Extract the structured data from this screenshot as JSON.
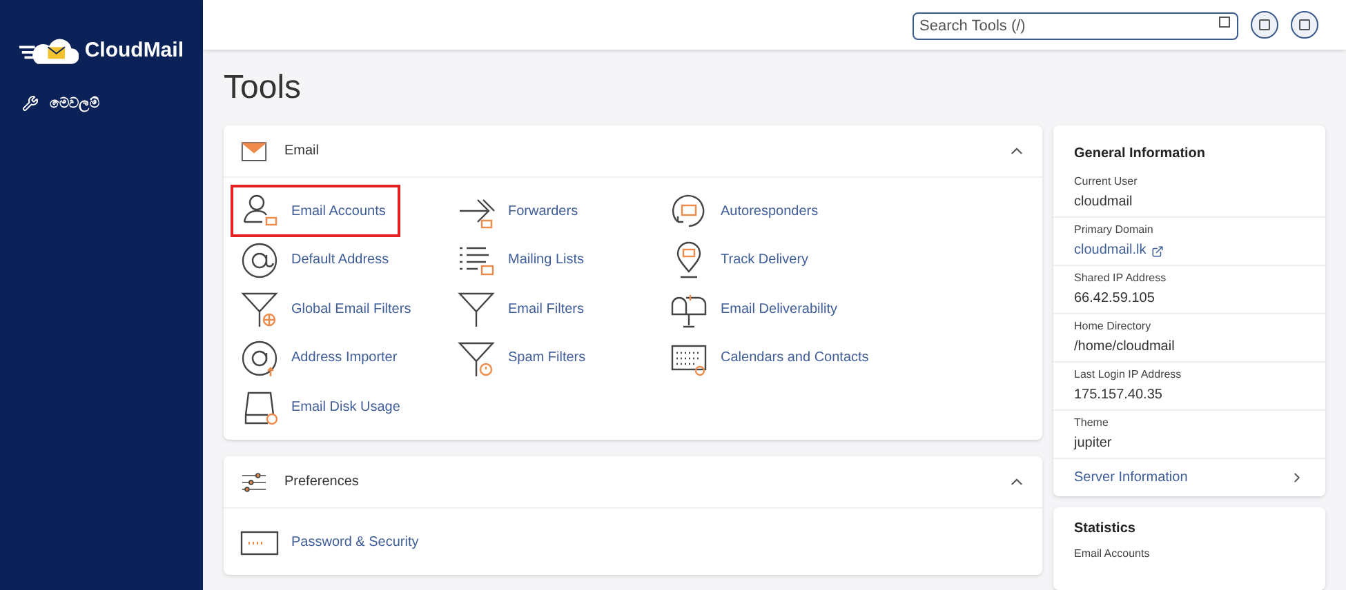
{
  "sidebar": {
    "logo": "CloudMail",
    "items": [
      {
        "label": "මෙවලම්",
        "selected": true
      }
    ]
  },
  "header": {
    "search": {
      "placeholder": "Search Tools (/)"
    }
  },
  "page": {
    "title": "Tools"
  },
  "sections": [
    {
      "title": "Email",
      "kind": "email",
      "expanded": true,
      "items": [
        {
          "label": "Email Accounts",
          "kind": "user",
          "highlighted": true
        },
        {
          "label": "Forwarders",
          "kind": "forward",
          "highlighted": false
        },
        {
          "label": "Autoresponders",
          "kind": "autorespond",
          "highlighted": false
        },
        {
          "label": "Default Address",
          "kind": "at",
          "highlighted": false
        },
        {
          "label": "Mailing Lists",
          "kind": "list",
          "highlighted": false
        },
        {
          "label": "Track Delivery",
          "kind": "pin",
          "highlighted": false
        },
        {
          "label": "Global Email Filters",
          "kind": "globefilter",
          "highlighted": false
        },
        {
          "label": "Email Filters",
          "kind": "filter",
          "highlighted": false
        },
        {
          "label": "Email Deliverability",
          "kind": "mailbox",
          "highlighted": false
        },
        {
          "label": "Address Importer",
          "kind": "atimport",
          "highlighted": false
        },
        {
          "label": "Spam Filters",
          "kind": "spamfilter",
          "highlighted": false
        },
        {
          "label": "Calendars and Contacts",
          "kind": "calendar",
          "highlighted": false
        },
        {
          "label": "Email Disk Usage",
          "kind": "disk",
          "highlighted": false
        }
      ]
    },
    {
      "title": "Preferences",
      "kind": "prefs",
      "expanded": true,
      "items": [
        {
          "label": "Password & Security",
          "kind": "password",
          "highlighted": false
        }
      ]
    }
  ],
  "general_information": {
    "title": "General Information",
    "fields": [
      {
        "label": "Current User",
        "value": "cloudmail",
        "kind": "text"
      },
      {
        "label": "Primary Domain",
        "value": "cloudmail.lk",
        "kind": "link"
      },
      {
        "label": "Shared IP Address",
        "value": "66.42.59.105",
        "kind": "text"
      },
      {
        "label": "Home Directory",
        "value": "/home/cloudmail",
        "kind": "text"
      },
      {
        "label": "Last Login IP Address",
        "value": "175.157.40.35",
        "kind": "text"
      },
      {
        "label": "Theme",
        "value": "jupiter",
        "kind": "text"
      }
    ],
    "footer_link": "Server Information"
  },
  "statistics": {
    "title": "Statistics",
    "first_label": "Email Accounts"
  }
}
